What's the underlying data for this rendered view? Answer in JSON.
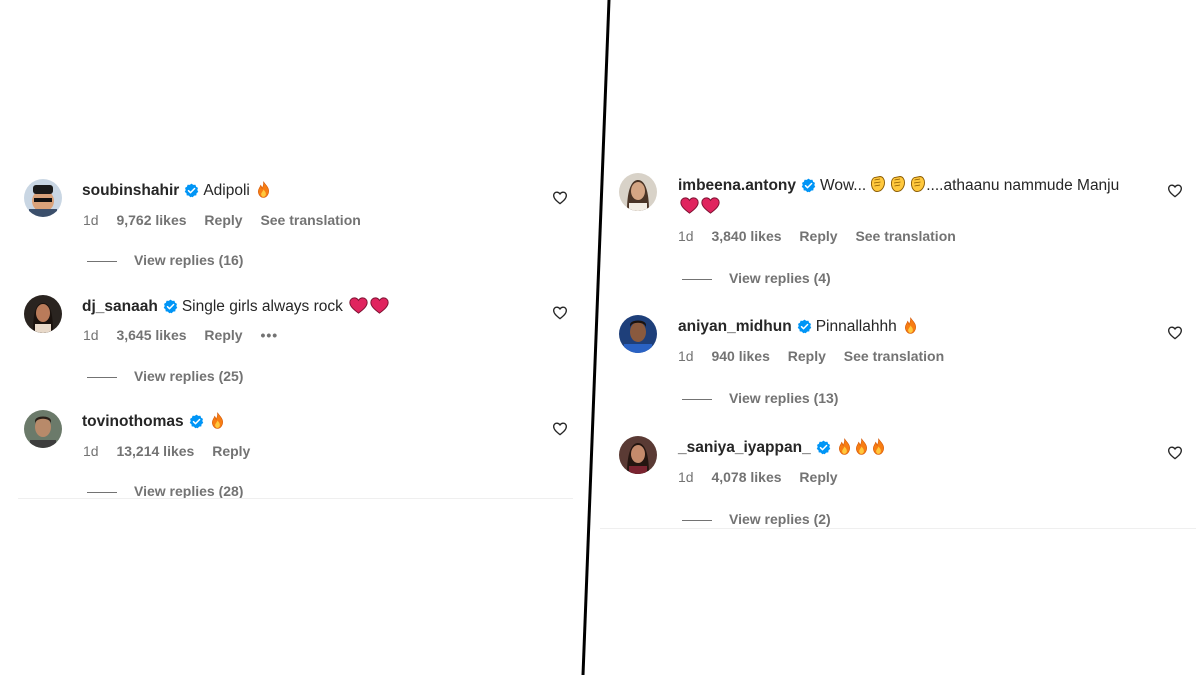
{
  "left_panel": {
    "comments": [
      {
        "username": "soubinshahir",
        "text": "Adipoli",
        "emoji": [
          "fire"
        ],
        "time": "1d",
        "likes": "9,762 likes",
        "reply": "Reply",
        "translate": "See translation",
        "replies": "View replies (16)"
      },
      {
        "username": "dj_sanaah",
        "text": "Single girls always rock",
        "emoji": [
          "red-heart",
          "red-heart"
        ],
        "time": "1d",
        "likes": "3,645 likes",
        "reply": "Reply",
        "more": "•••",
        "replies": "View replies (25)"
      },
      {
        "username": "tovinothomas",
        "text": "",
        "emoji": [
          "fire"
        ],
        "time": "1d",
        "likes": "13,214 likes",
        "reply": "Reply",
        "replies": "View replies (28)"
      }
    ]
  },
  "right_panel": {
    "comments": [
      {
        "username": "imbeena.antony",
        "text_before": "Wow...",
        "text_after": "....athaanu nammude Manju",
        "emoji_mid": [
          "clap",
          "clap",
          "clap"
        ],
        "emoji_line2": [
          "red-heart",
          "red-heart"
        ],
        "time": "1d",
        "likes": "3,840 likes",
        "reply": "Reply",
        "translate": "See translation",
        "replies": "View replies (4)"
      },
      {
        "username": "aniyan_midhun",
        "text": "Pinnallahhh",
        "emoji": [
          "fire"
        ],
        "time": "1d",
        "likes": "940 likes",
        "reply": "Reply",
        "translate": "See translation",
        "replies": "View replies (13)"
      },
      {
        "username": "_saniya_iyappan_",
        "text": "",
        "emoji": [
          "fire",
          "fire",
          "fire"
        ],
        "time": "1d",
        "likes": "4,078 likes",
        "reply": "Reply",
        "replies": "View replies (2)"
      }
    ]
  },
  "colors": {
    "verified": "#0095f6",
    "meta": "#737373",
    "text": "#262626",
    "divider": "#000000",
    "fire": "#f77d13",
    "heart": "#e0245e"
  }
}
